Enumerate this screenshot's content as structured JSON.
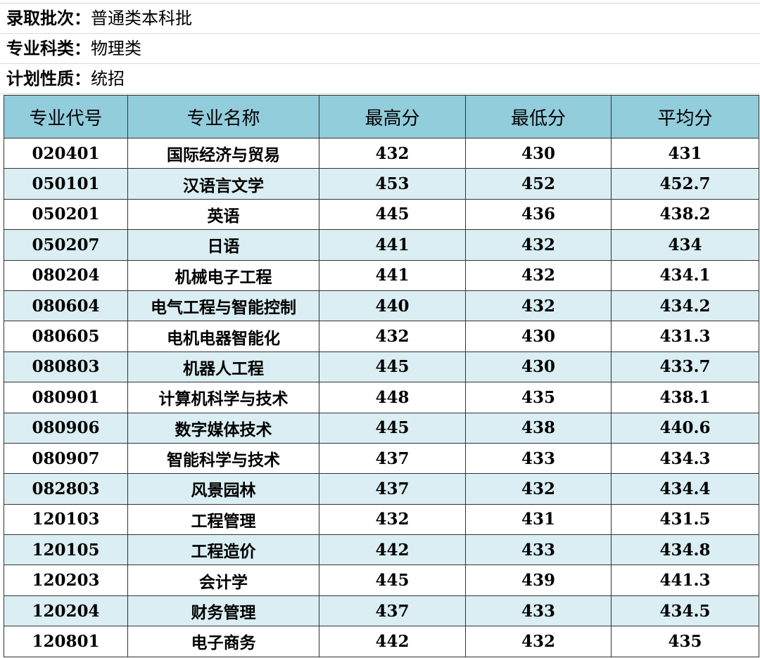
{
  "info": {
    "batch_label": "录取批次：",
    "batch_value": "普通类本科批",
    "category_label": "专业科类：",
    "category_value": "物理类",
    "plan_label": "计划性质：",
    "plan_value": "统招"
  },
  "table": {
    "headers": [
      "专业代号",
      "专业名称",
      "最高分",
      "最低分",
      "平均分"
    ],
    "rows": [
      [
        "020401",
        "国际经济与贸易",
        "432",
        "430",
        "431"
      ],
      [
        "050101",
        "汉语言文学",
        "453",
        "452",
        "452.7"
      ],
      [
        "050201",
        "英语",
        "445",
        "436",
        "438.2"
      ],
      [
        "050207",
        "日语",
        "441",
        "432",
        "434"
      ],
      [
        "080204",
        "机械电子工程",
        "441",
        "432",
        "434.1"
      ],
      [
        "080604",
        "电气工程与智能控制",
        "440",
        "432",
        "434.2"
      ],
      [
        "080605",
        "电机电器智能化",
        "432",
        "430",
        "431.3"
      ],
      [
        "080803",
        "机器人工程",
        "445",
        "430",
        "433.7"
      ],
      [
        "080901",
        "计算机科学与技术",
        "448",
        "435",
        "438.1"
      ],
      [
        "080906",
        "数字媒体技术",
        "445",
        "438",
        "440.6"
      ],
      [
        "080907",
        "智能科学与技术",
        "437",
        "433",
        "434.3"
      ],
      [
        "082803",
        "风景园林",
        "437",
        "432",
        "434.4"
      ],
      [
        "120103",
        "工程管理",
        "432",
        "431",
        "431.5"
      ],
      [
        "120105",
        "工程造价",
        "442",
        "433",
        "434.8"
      ],
      [
        "120203",
        "会计学",
        "445",
        "439",
        "441.3"
      ],
      [
        "120204",
        "财务管理",
        "437",
        "433",
        "434.5"
      ],
      [
        "120801",
        "电子商务",
        "442",
        "432",
        "435"
      ]
    ]
  },
  "colors": {
    "header_bg": "#92cddc",
    "alt_row_bg": "#daeef3"
  }
}
